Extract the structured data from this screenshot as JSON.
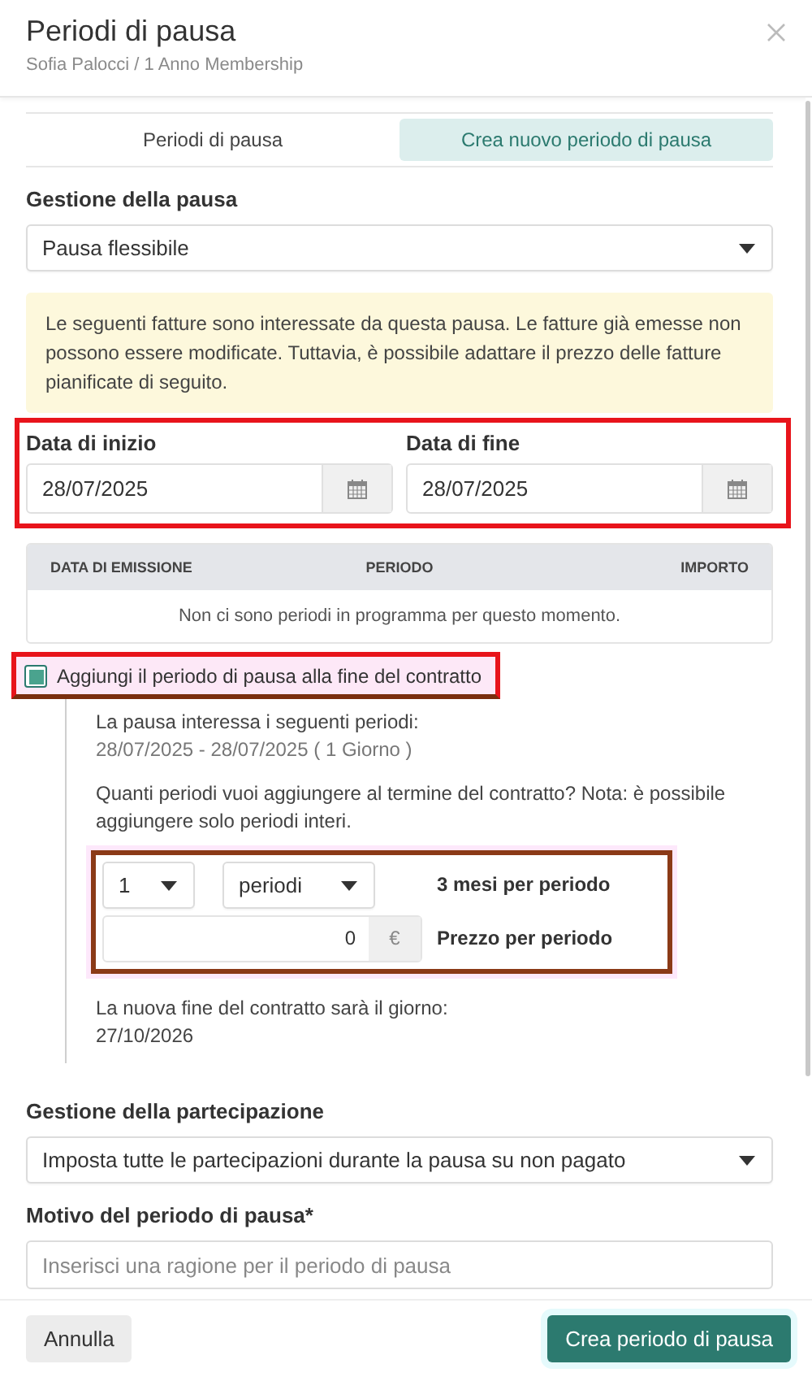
{
  "dialog": {
    "title": "Periodi di pausa",
    "subtitle": "Sofia Palocci / 1 Anno Membership"
  },
  "tabs": [
    {
      "label": "Periodi di pausa",
      "selected": false
    },
    {
      "label": "Crea nuovo periodo di pausa",
      "selected": true
    }
  ],
  "pause_management": {
    "label": "Gestione della pausa",
    "value": "Pausa flessibile"
  },
  "notice": "Le seguenti fatture sono interessate da questa pausa. Le fatture già emesse non possono essere modificate. Tuttavia, è possibile adattare il prezzo delle fatture pianificate di seguito.",
  "dates": {
    "highlighted": true,
    "fields": [
      {
        "label": "Data di inizio",
        "value": "28/07/2025"
      },
      {
        "label": "Data di fine",
        "value": "28/07/2025"
      }
    ]
  },
  "table": {
    "columns": [
      "DATA DI EMISSIONE",
      "PERIODO",
      "IMPORTO"
    ],
    "empty_message": "Non ci sono periodi in programma per questo momento."
  },
  "extend": {
    "label": "Aggiungi il periodo di pausa alla fine del contratto",
    "checked": true,
    "highlighted": true,
    "affected_label": "La pausa interessa i seguenti periodi:",
    "affected_range": "28/07/2025 - 28/07/2025 ( 1 Giorno )",
    "question": "Quanti periodi vuoi aggiungere al termine del contratto? Nota: è possibile aggiungere solo periodi interi.",
    "periods": {
      "highlighted": true,
      "count": "1",
      "unit": "periodi",
      "period_info": "3 mesi per periodo",
      "price": "0",
      "currency": "€",
      "price_label": "Prezzo per periodo"
    },
    "new_end_label": "La nuova fine del contratto sarà il giorno:",
    "new_end_date": "27/10/2026"
  },
  "participation": {
    "label": "Gestione della partecipazione",
    "value": "Imposta tutte le partecipazioni durante la pausa su non pagato"
  },
  "reason": {
    "label": "Motivo del periodo di pausa*",
    "placeholder": "Inserisci una ragione per il periodo di pausa"
  },
  "buttons": [
    {
      "label": "Annulla",
      "kind": "secondary"
    },
    {
      "label": "Crea periodo di pausa",
      "kind": "primary"
    }
  ]
}
